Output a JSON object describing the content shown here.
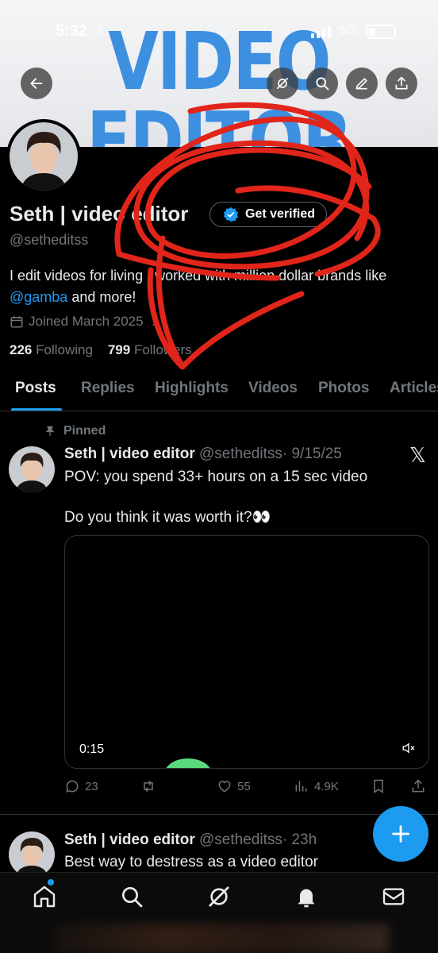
{
  "status_bar": {
    "time": "5:32",
    "network": "5G"
  },
  "banner": {
    "title": "VIDEO EDITOR"
  },
  "profile": {
    "name": "Seth | video editor",
    "handle": "@setheditss",
    "get_verified_label": "Get verified",
    "bio_before": "I edit videos for living I worked with million dollar brands like ",
    "bio_mention": "@gamba",
    "bio_after": " and more!",
    "joined": "Joined March 2025",
    "following_count": "226",
    "following_label": "Following",
    "followers_count": "799",
    "followers_label": "Followers"
  },
  "tabs": [
    "Posts",
    "Replies",
    "Highlights",
    "Videos",
    "Photos",
    "Articles"
  ],
  "posts": [
    {
      "pinned_label": "Pinned",
      "author_name": "Seth | video editor",
      "author_handle": "@setheditss",
      "date": "· 9/15/25",
      "text_line1": "POV: you spend 33+ hours on a 15 sec video",
      "text_line2": "Do you think it was worth it?👀",
      "video_duration": "0:15",
      "replies": "23",
      "reposts": "",
      "likes": "55",
      "views": "4.9K"
    },
    {
      "author_name": "Seth | video editor",
      "author_handle": "@setheditss",
      "date": "· 23h",
      "text_line1": "Best way to destress as a video editor"
    }
  ],
  "colors": {
    "accent": "#1d9bf0",
    "banner_text": "#3d8fe0",
    "scribble": "#e1251b"
  }
}
